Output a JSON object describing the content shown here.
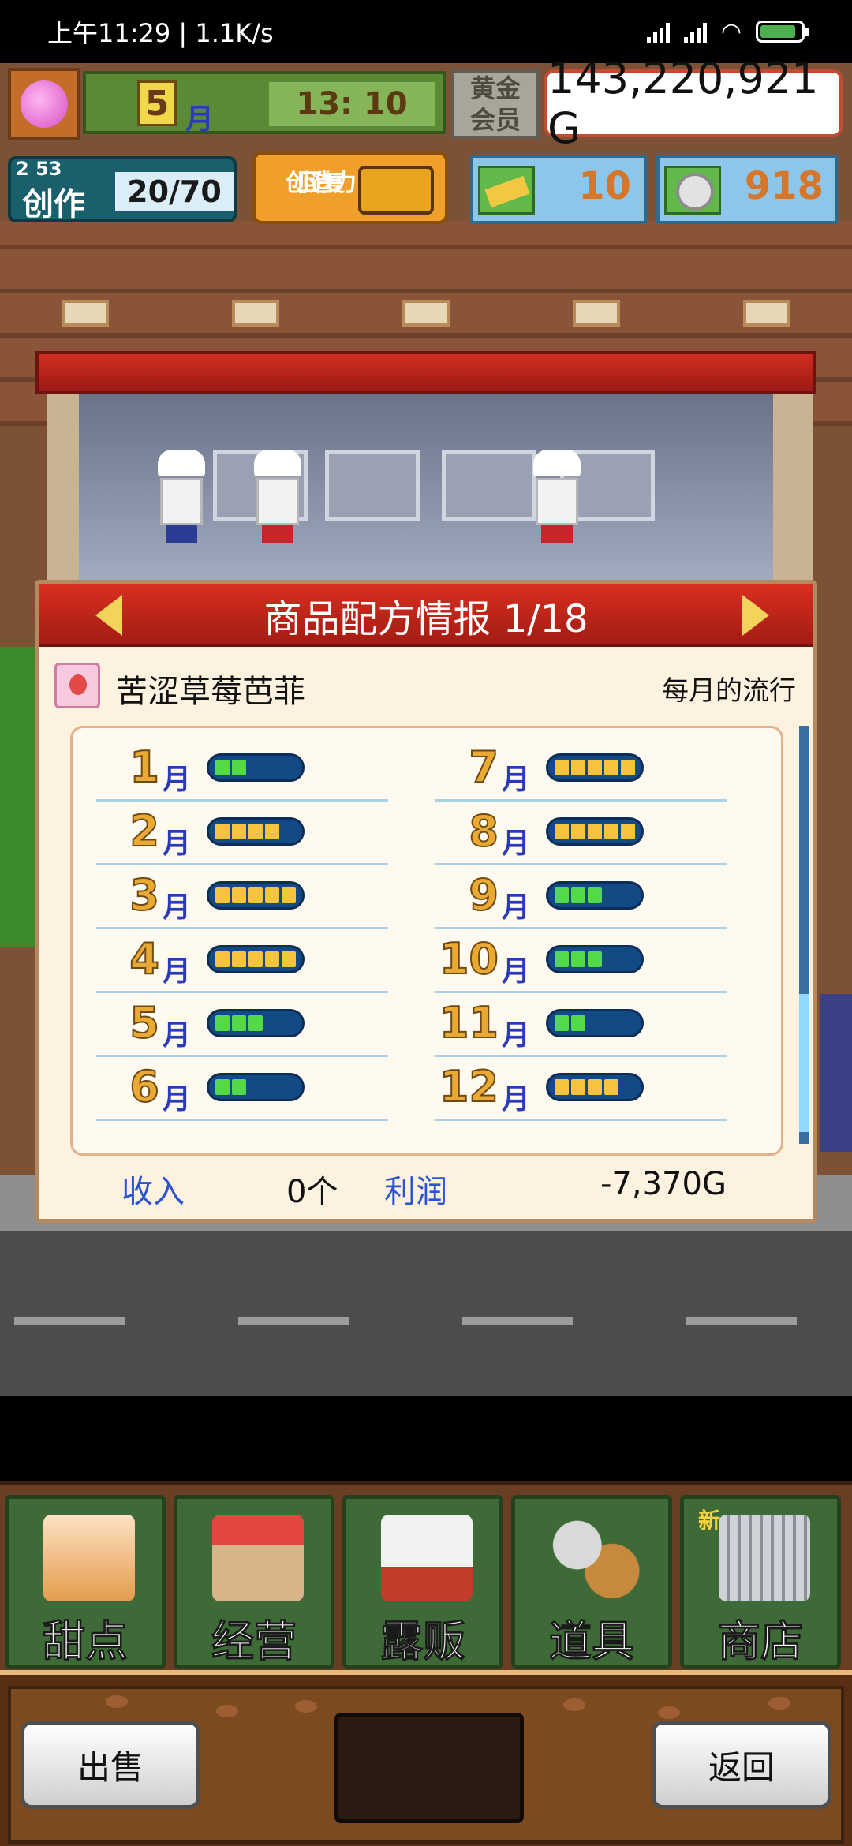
{
  "status_bar": {
    "time_speed": "上午11:29 | 1.1K/s"
  },
  "hud": {
    "month": "5",
    "month_unit": "月",
    "time": "13: 10",
    "vip_label_1": "黄金",
    "vip_label_2": "会员",
    "money": "143,220,921 G",
    "create_level": "2",
    "create_sub": "53",
    "create_label": "创作",
    "create_count": "20/70",
    "restore_label_1": "回复",
    "restore_label_2": "创造力",
    "tickets": "10",
    "coins": "918"
  },
  "dialog": {
    "title": "商品配方情报 1/18",
    "item_name": "苦涩草莓芭菲",
    "trend_label": "每月的流行",
    "months": [
      {
        "num": "1",
        "unit": "月",
        "level": 2,
        "color": "g"
      },
      {
        "num": "2",
        "unit": "月",
        "level": 4,
        "color": "y"
      },
      {
        "num": "3",
        "unit": "月",
        "level": 5,
        "color": "y"
      },
      {
        "num": "4",
        "unit": "月",
        "level": 5,
        "color": "y"
      },
      {
        "num": "5",
        "unit": "月",
        "level": 3,
        "color": "g"
      },
      {
        "num": "6",
        "unit": "月",
        "level": 2,
        "color": "g"
      },
      {
        "num": "7",
        "unit": "月",
        "level": 5,
        "color": "y"
      },
      {
        "num": "8",
        "unit": "月",
        "level": 5,
        "color": "y"
      },
      {
        "num": "9",
        "unit": "月",
        "level": 3,
        "color": "g"
      },
      {
        "num": "10",
        "unit": "月",
        "level": 3,
        "color": "g"
      },
      {
        "num": "11",
        "unit": "月",
        "level": 2,
        "color": "g"
      },
      {
        "num": "12",
        "unit": "月",
        "level": 4,
        "color": "y"
      }
    ],
    "income_label": "收入",
    "income_value": "0个",
    "profit_label": "利润",
    "profit_value": "-7,370G"
  },
  "menu": {
    "items": [
      {
        "label": "甜点"
      },
      {
        "label": "经营"
      },
      {
        "label": "露贩"
      },
      {
        "label": "道具"
      },
      {
        "label": "商店",
        "badge": "新"
      }
    ]
  },
  "actions": {
    "sell": "出售",
    "back": "返回"
  },
  "colors": {
    "bar_green": "#54d94a",
    "bar_yellow": "#f7c43c",
    "header_red": "#d92f20"
  }
}
